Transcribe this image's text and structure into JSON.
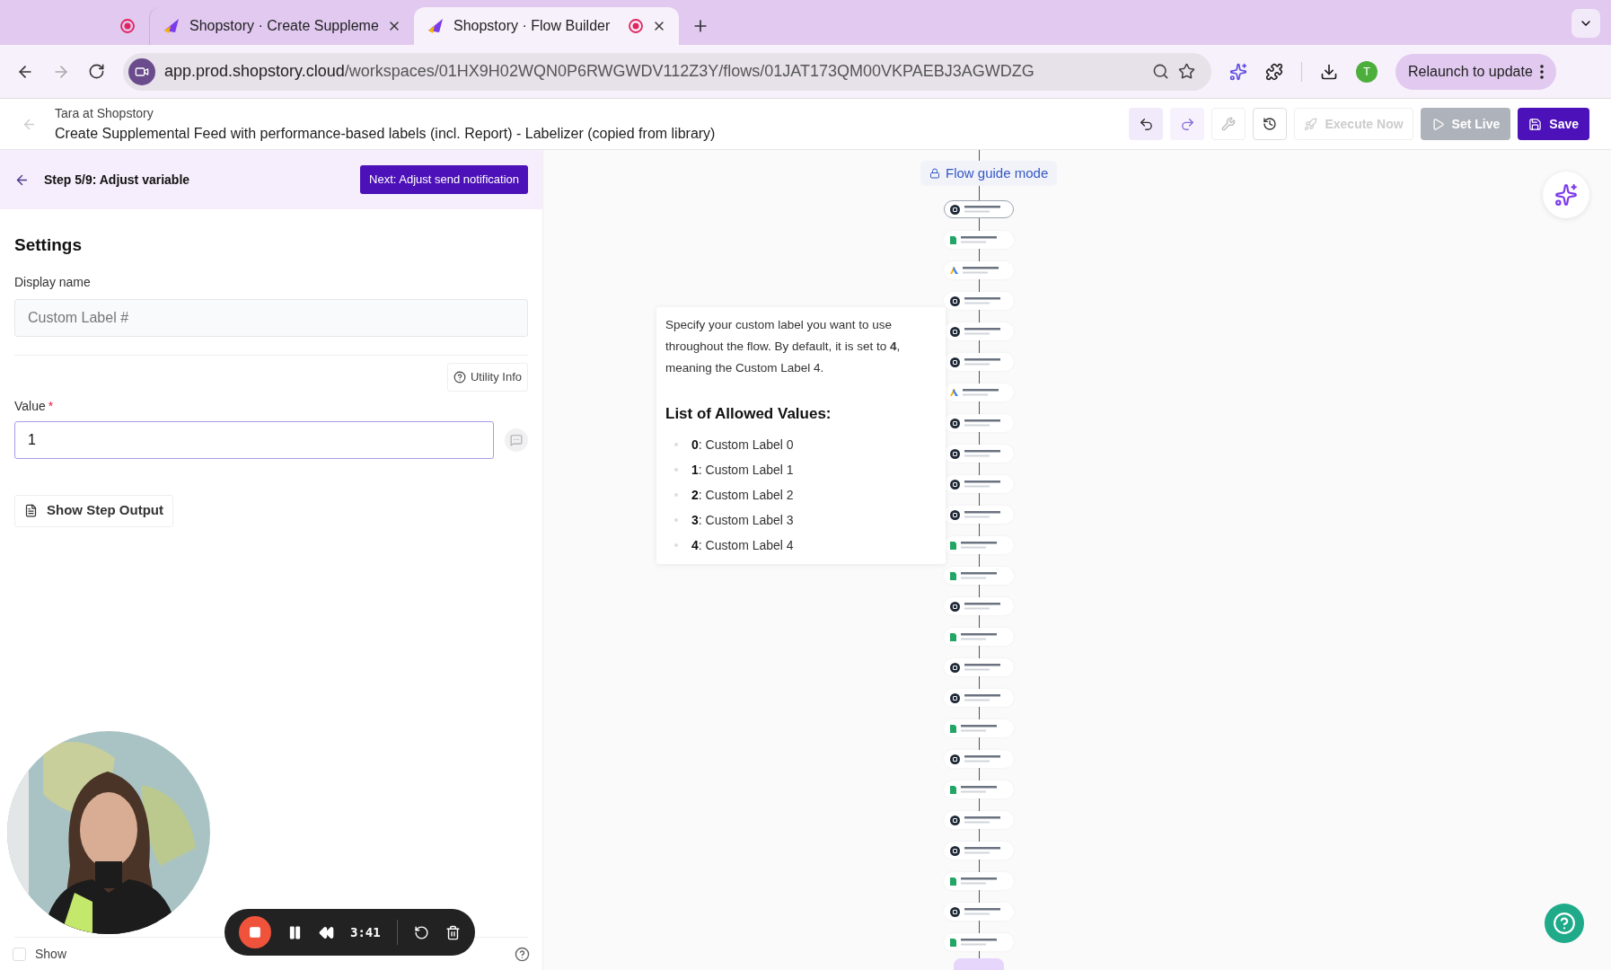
{
  "browser": {
    "tabs": [
      {
        "kind": "pinned",
        "recording": true,
        "selected": false
      },
      {
        "kind": "page",
        "title": "Shopstory · Create Suppleme",
        "recording": false,
        "selected": false
      },
      {
        "kind": "page",
        "title": "Shopstory · Flow Builder",
        "recording": true,
        "selected": true
      }
    ],
    "url_host": "app.prod.shopstory.cloud",
    "url_path": "/workspaces/01HX9H02WQN0P6RWGWDV112Z3Y/flows/01JAT173QM00VKPAEBJ3AGWDZG",
    "profile_initial": "T",
    "relaunch": "Relaunch to update"
  },
  "header": {
    "workspace": "Tara at Shopstory",
    "title": "Create Supplemental Feed with performance-based labels (incl. Report) - Labelizer (copied from library)",
    "execute": "Execute Now",
    "set_live": "Set Live",
    "save": "Save"
  },
  "step": {
    "title": "Step 5/9: Adjust variable",
    "next": "Next: Adjust send notification"
  },
  "settings": {
    "heading": "Settings",
    "display_name_label": "Display name",
    "display_name_placeholder": "Custom Label #",
    "utility_info": "Utility Info",
    "value_label": "Value",
    "required_mark": "*",
    "value": "1",
    "show_output": "Show Step Output",
    "show_label": "Show",
    "show_checked": false
  },
  "guide": {
    "mode": "Flow guide mode",
    "intro": "Specify your custom label you want to use throughout the flow. By default, it is set to **4**, meaning the Custom Label 4.",
    "list_title": "List of Allowed Values:",
    "values": [
      {
        "key": "0",
        "label": ": Custom Label 0"
      },
      {
        "key": "1",
        "label": ": Custom Label 1"
      },
      {
        "key": "2",
        "label": ": Custom Label 2"
      },
      {
        "key": "3",
        "label": ": Custom Label 3"
      },
      {
        "key": "4",
        "label": ": Custom Label 4"
      }
    ]
  },
  "flow": {
    "nodes": [
      {
        "kind": "code",
        "selected": true
      },
      {
        "kind": "sheet",
        "selected": false
      },
      {
        "kind": "ads",
        "selected": false
      },
      {
        "kind": "code",
        "selected": false
      },
      {
        "kind": "code",
        "selected": false
      },
      {
        "kind": "code",
        "selected": false
      },
      {
        "kind": "ads",
        "selected": false
      },
      {
        "kind": "code",
        "selected": false
      },
      {
        "kind": "code",
        "selected": false
      },
      {
        "kind": "code",
        "selected": false
      },
      {
        "kind": "code",
        "selected": false
      },
      {
        "kind": "sheet",
        "selected": false
      },
      {
        "kind": "sheet",
        "selected": false
      },
      {
        "kind": "code",
        "selected": false
      },
      {
        "kind": "sheet",
        "selected": false
      },
      {
        "kind": "code",
        "selected": false
      },
      {
        "kind": "code",
        "selected": false
      },
      {
        "kind": "sheet",
        "selected": false
      },
      {
        "kind": "code",
        "selected": false
      },
      {
        "kind": "sheet",
        "selected": false
      },
      {
        "kind": "code",
        "selected": false
      },
      {
        "kind": "code",
        "selected": false
      },
      {
        "kind": "sheet",
        "selected": false
      },
      {
        "kind": "code",
        "selected": false
      },
      {
        "kind": "sheet",
        "selected": false
      }
    ]
  },
  "recorder": {
    "time": "3:41"
  }
}
